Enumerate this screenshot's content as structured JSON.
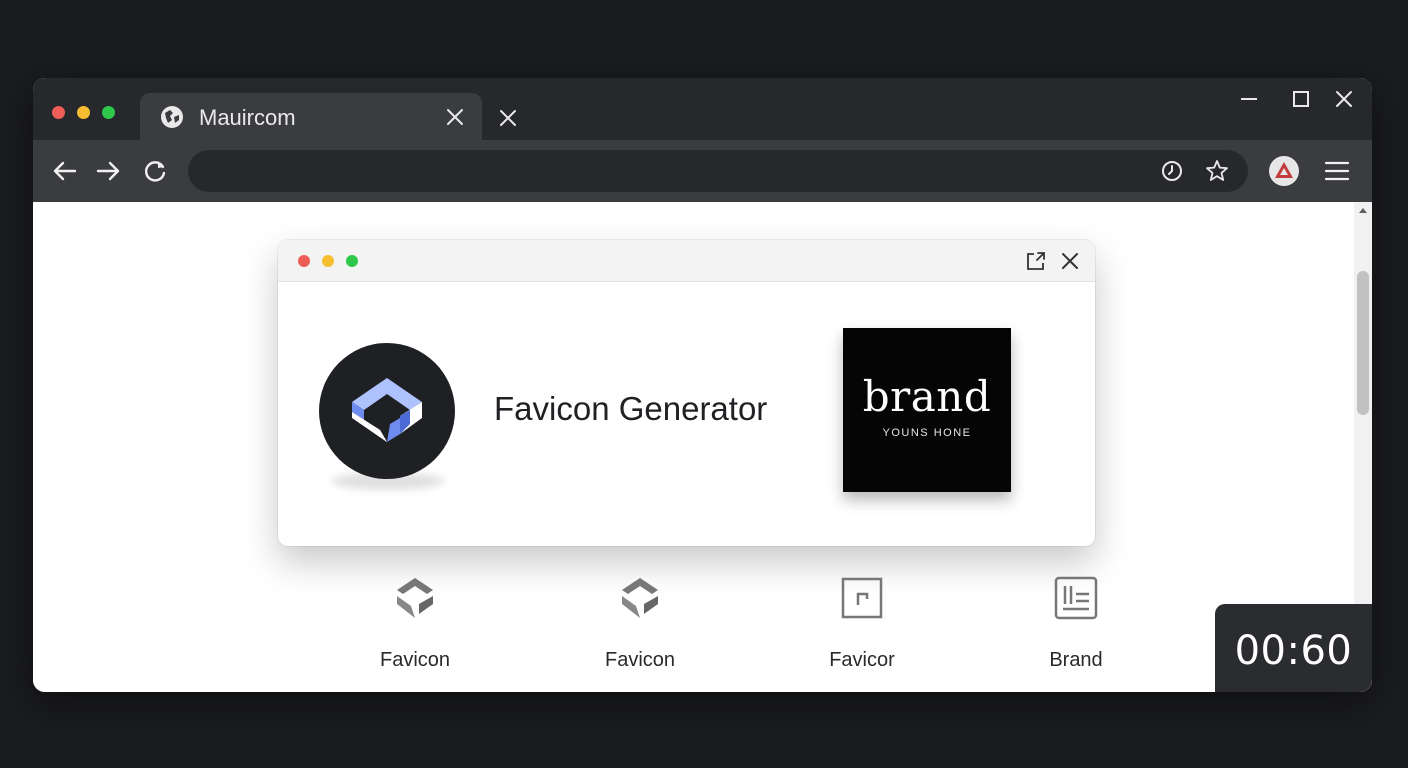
{
  "window": {
    "traffic_lights": {
      "close": "#ee5d56",
      "minimize": "#f5bd2f",
      "maximize": "#2ec84a"
    },
    "tab": {
      "title": "Mauircom",
      "icon": "globe-icon",
      "close_icon": "close-icon"
    },
    "new_tab_icon": "close-icon",
    "controls": [
      "minimize-icon",
      "maximize-icon",
      "close-icon"
    ]
  },
  "toolbar": {
    "nav": [
      "back-arrow-icon",
      "forward-arrow-icon",
      "reload-icon"
    ],
    "address": {
      "value": "",
      "placeholder": ""
    },
    "address_icons": [
      "history-clock-icon",
      "bookmark-star-icon"
    ],
    "profile_icon": "profile-avatar-icon",
    "menu_icon": "hamburger-menu-icon"
  },
  "modal": {
    "dots": {
      "close": "#ee5d56",
      "minimize": "#f5bd2f",
      "maximize": "#2ec84a"
    },
    "title": "Favicon Generator",
    "logo_icon": "cube-logo-icon",
    "logo_colors": {
      "background": "#1f2023",
      "accent_light": "#aec2ff",
      "accent_mid": "#6e8cf0",
      "accent_dark": "#4b6bd6"
    },
    "brand_tile": {
      "word": "brand",
      "tagline": "YOUNS HONE"
    },
    "controls": [
      "open-external-icon",
      "close-icon"
    ]
  },
  "favicons": [
    {
      "label": "Favicon",
      "icon": "cube-favicon-icon"
    },
    {
      "label": "Favicon",
      "icon": "cube-favicon-icon"
    },
    {
      "label": "Favicor",
      "icon": "square-favicon-icon"
    },
    {
      "label": "Brand",
      "icon": "layout-favicon-icon"
    }
  ],
  "timer": {
    "value": "00:60"
  },
  "colors": {
    "page_background": "#1b1c1f",
    "tab_strip": "#27282c",
    "active_tab": "#3b3c40",
    "toolbar": "#3b3c40",
    "omnibox": "#27282c",
    "favicon_gray": "#6f6f6f"
  }
}
